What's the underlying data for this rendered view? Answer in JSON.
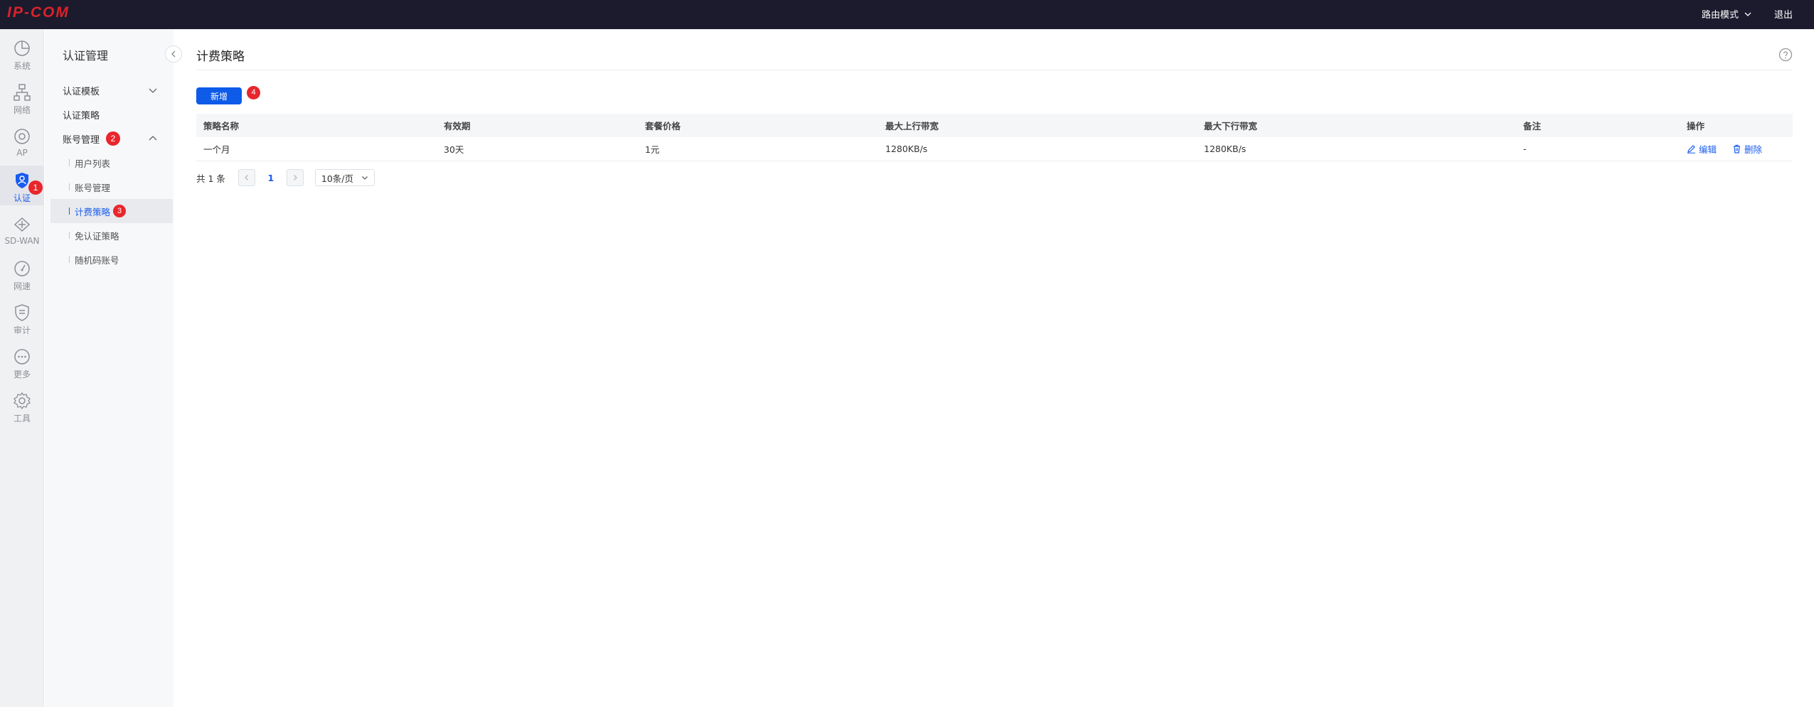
{
  "topbar": {
    "logo": "IP-COM",
    "mode": "路由模式",
    "logout": "退出"
  },
  "rail": {
    "items": [
      {
        "label": "系统",
        "icon": "pie-chart-icon"
      },
      {
        "label": "网络",
        "icon": "network-topology-icon"
      },
      {
        "label": "AP",
        "icon": "ap-icon"
      },
      {
        "label": "认证",
        "icon": "user-auth-icon",
        "active": true,
        "badge": "1"
      },
      {
        "label": "SD-WAN",
        "icon": "sdwan-icon"
      },
      {
        "label": "网速",
        "icon": "speedometer-icon"
      },
      {
        "label": "审计",
        "icon": "shield-icon"
      },
      {
        "label": "更多",
        "icon": "more-icon"
      },
      {
        "label": "工具",
        "icon": "gear-icon"
      }
    ]
  },
  "subnav": {
    "title": "认证管理",
    "items": [
      {
        "label": "认证模板"
      },
      {
        "label": "认证策略"
      },
      {
        "label": "账号管理",
        "badge": "2"
      }
    ],
    "sub_items": [
      {
        "label": "用户列表"
      },
      {
        "label": "账号管理"
      },
      {
        "label": "计费策略",
        "badge": "3"
      },
      {
        "label": "免认证策略"
      },
      {
        "label": "随机码账号"
      }
    ]
  },
  "main": {
    "title": "计费策略",
    "add_label": "新增",
    "add_badge": "4",
    "table": {
      "headers": [
        "策略名称",
        "有效期",
        "套餐价格",
        "最大上行带宽",
        "最大下行带宽",
        "备注",
        "操作"
      ],
      "rows": [
        {
          "name": "一个月",
          "validity": "30天",
          "price": "1元",
          "up": "1280KB/s",
          "down": "1280KB/s",
          "remark": "-"
        }
      ],
      "edit_label": "编辑",
      "delete_label": "删除"
    },
    "pager": {
      "total": "共 1 条",
      "current": "1",
      "page_size": "10条/页"
    }
  },
  "colors": {
    "accent": "#0d5be8",
    "badge": "#e8262c",
    "topbar": "#1c1b2e",
    "logo": "#d9232a"
  }
}
